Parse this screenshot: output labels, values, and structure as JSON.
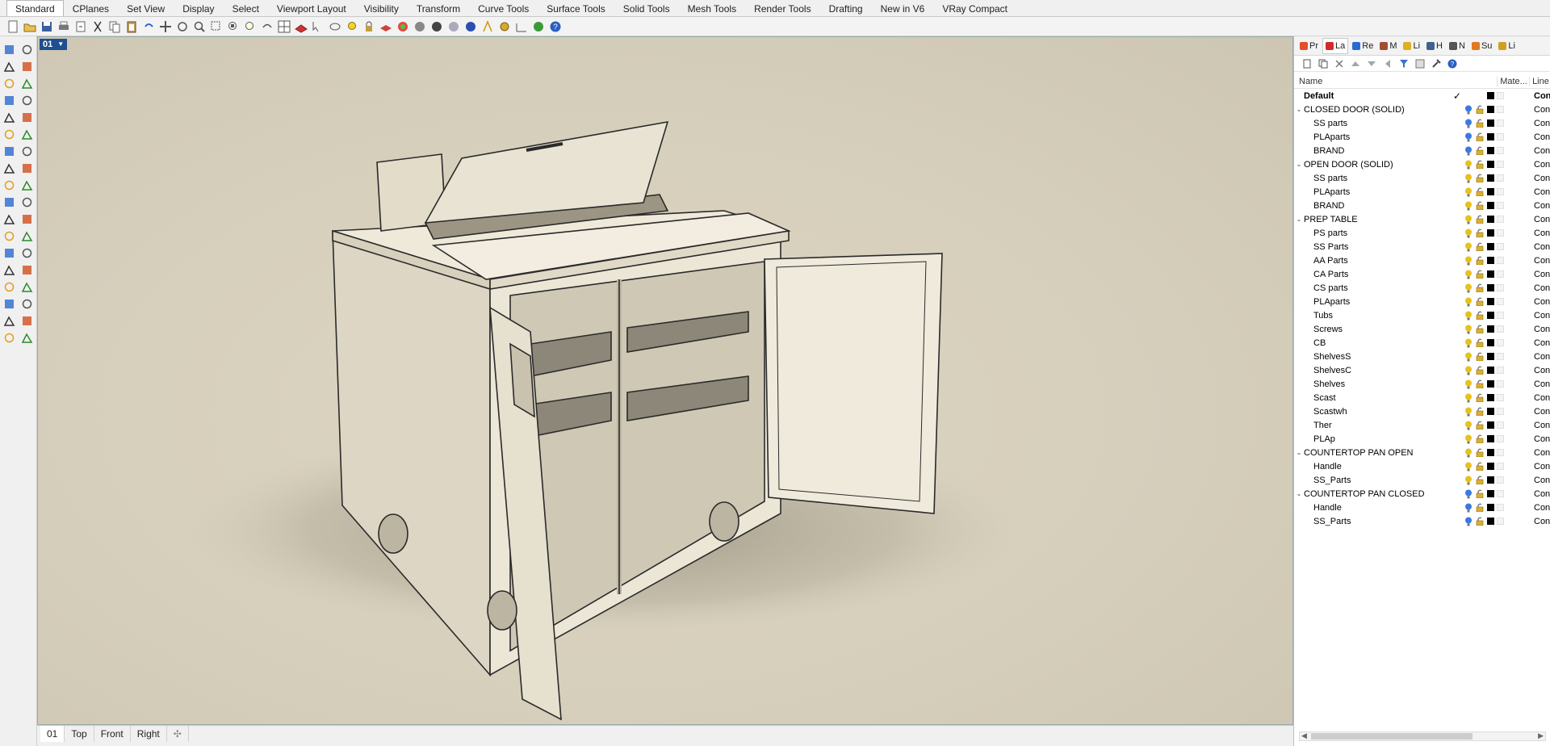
{
  "tabs": [
    "Standard",
    "CPlanes",
    "Set View",
    "Display",
    "Select",
    "Viewport Layout",
    "Visibility",
    "Transform",
    "Curve Tools",
    "Surface Tools",
    "Solid Tools",
    "Mesh Tools",
    "Render Tools",
    "Drafting",
    "New in V6",
    "VRay Compact"
  ],
  "viewport": {
    "label": "01",
    "tabs": [
      "01",
      "Top",
      "Front",
      "Right"
    ]
  },
  "panel": {
    "tabs": [
      {
        "label": "Pr",
        "color": "#e0502a"
      },
      {
        "label": "La",
        "color": "#d02a2a"
      },
      {
        "label": "Re",
        "color": "#2a6ad0"
      },
      {
        "label": "M",
        "color": "#a05030"
      },
      {
        "label": "Li",
        "color": "#e0b020"
      },
      {
        "label": "H",
        "color": "#406090"
      },
      {
        "label": "N",
        "color": "#555555"
      },
      {
        "label": "Su",
        "color": "#e07a20"
      },
      {
        "label": "Li",
        "color": "#d0a020"
      }
    ],
    "columns": {
      "name": "Name",
      "material": "Mate...",
      "linetype": "Line"
    },
    "layers": [
      {
        "name": "Default",
        "level": 0,
        "bold": true,
        "current": true,
        "expandable": false,
        "line": "Con"
      },
      {
        "name": "CLOSED DOOR (SOLID)",
        "level": 0,
        "expandable": true,
        "line": "Con",
        "bulb": "#3a7adf"
      },
      {
        "name": "SS parts",
        "level": 1,
        "line": "Con",
        "bulb": "#3a7adf"
      },
      {
        "name": "PLAparts",
        "level": 1,
        "line": "Con",
        "bulb": "#3a7adf"
      },
      {
        "name": "BRAND",
        "level": 1,
        "line": "Con",
        "bulb": "#3a7adf"
      },
      {
        "name": "OPEN DOOR (SOLID)",
        "level": 0,
        "expandable": true,
        "line": "Con",
        "bulb": "#e5c220"
      },
      {
        "name": "SS parts",
        "level": 1,
        "line": "Con",
        "bulb": "#e5c220"
      },
      {
        "name": "PLAparts",
        "level": 1,
        "line": "Con",
        "bulb": "#e5c220"
      },
      {
        "name": "BRAND",
        "level": 1,
        "line": "Con",
        "bulb": "#e5c220"
      },
      {
        "name": "PREP TABLE",
        "level": 0,
        "expandable": true,
        "line": "Con",
        "bulb": "#e5c220"
      },
      {
        "name": "PS parts",
        "level": 1,
        "line": "Con",
        "bulb": "#e5c220"
      },
      {
        "name": "SS Parts",
        "level": 1,
        "line": "Con",
        "bulb": "#e5c220"
      },
      {
        "name": "AA Parts",
        "level": 1,
        "line": "Con",
        "bulb": "#e5c220"
      },
      {
        "name": "CA Parts",
        "level": 1,
        "line": "Con",
        "bulb": "#e5c220"
      },
      {
        "name": "CS parts",
        "level": 1,
        "line": "Con",
        "bulb": "#e5c220"
      },
      {
        "name": "PLAparts",
        "level": 1,
        "line": "Con",
        "bulb": "#e5c220"
      },
      {
        "name": "Tubs",
        "level": 1,
        "line": "Con",
        "bulb": "#e5c220"
      },
      {
        "name": "Screws",
        "level": 1,
        "line": "Con",
        "bulb": "#e5c220"
      },
      {
        "name": "CB",
        "level": 1,
        "line": "Con",
        "bulb": "#e5c220"
      },
      {
        "name": "ShelvesS",
        "level": 1,
        "line": "Con",
        "bulb": "#e5c220"
      },
      {
        "name": "ShelvesC",
        "level": 1,
        "line": "Con",
        "bulb": "#e5c220"
      },
      {
        "name": "Shelves",
        "level": 1,
        "line": "Con",
        "bulb": "#e5c220"
      },
      {
        "name": "Scast",
        "level": 1,
        "line": "Con",
        "bulb": "#e5c220"
      },
      {
        "name": "Scastwh",
        "level": 1,
        "line": "Con",
        "bulb": "#e5c220"
      },
      {
        "name": "Ther",
        "level": 1,
        "line": "Con",
        "bulb": "#e5c220"
      },
      {
        "name": "PLAp",
        "level": 1,
        "line": "Con",
        "bulb": "#e5c220"
      },
      {
        "name": "COUNTERTOP PAN OPEN",
        "level": 0,
        "expandable": true,
        "line": "Con",
        "bulb": "#e5c220"
      },
      {
        "name": "Handle",
        "level": 1,
        "line": "Con",
        "bulb": "#e5c220"
      },
      {
        "name": "SS_Parts",
        "level": 1,
        "line": "Con",
        "bulb": "#e5c220"
      },
      {
        "name": "COUNTERTOP PAN CLOSED",
        "level": 0,
        "expandable": true,
        "line": "Con",
        "bulb": "#3a7adf"
      },
      {
        "name": "Handle",
        "level": 1,
        "line": "Con",
        "bulb": "#3a7adf"
      },
      {
        "name": "SS_Parts",
        "level": 1,
        "line": "Con",
        "bulb": "#3a7adf"
      }
    ]
  }
}
